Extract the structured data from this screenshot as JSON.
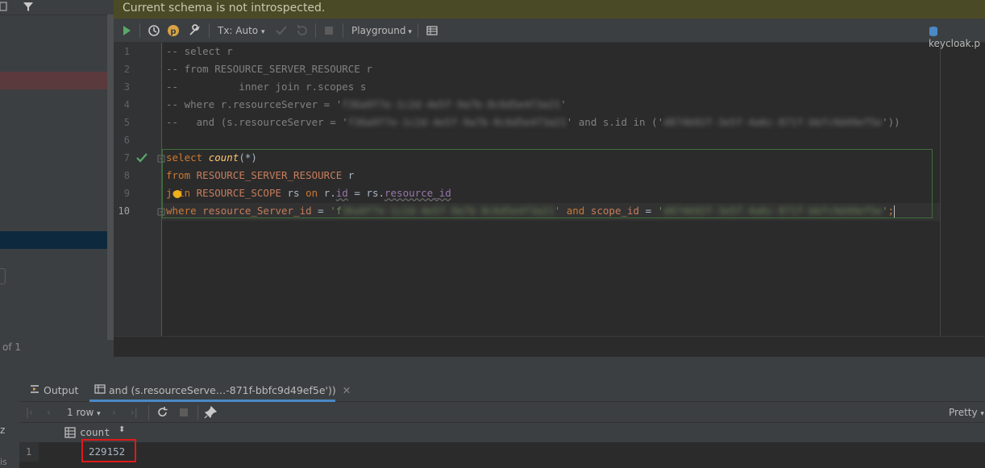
{
  "banner": {
    "message": "Current schema is not introspected."
  },
  "toolbar": {
    "tx_mode": "Tx: Auto",
    "playground": "Playground",
    "connection": "keycloak.p"
  },
  "left_panel": {
    "footer": "of 1",
    "cut_z": "z",
    "cut_s": "is"
  },
  "editor": {
    "lines": [
      "1",
      "2",
      "3",
      "4",
      "5",
      "6",
      "7",
      "8",
      "9",
      "10"
    ],
    "l1": "-- select r",
    "l2": "-- from RESOURCE_SERVER_RESOURCE r",
    "l3": "--          inner join r.scopes s",
    "l4a": "-- where r.resourceServer = '",
    "l4b": "f36a9f7e-1c2d-4e5f-9a7b-8c6d5e4f3a21",
    "l4c": "'",
    "l5a": "--   and (s.resourceServer = '",
    "l5b": "f36a9f7e-1c2d-4e5f-9a7b-8c6d5e4f3a21",
    "l5c": "' and s.id in ('",
    "l5d": "d874b92f-3e5f-4a6c-871f-bbfc9d49ef5e",
    "l5e": "'))",
    "l7_kw": "select",
    "l7_fn": "count",
    "l7_rest": "(*)",
    "l8_kw": "from",
    "l8_tbl": "RESOURCE_SERVER_RESOURCE",
    "l8_alias": "r",
    "l9_kw": "join",
    "l9_tbl": "RESOURCE_SCOPE",
    "l9_alias": "rs",
    "l9_on": "on",
    "l9_a": "r.",
    "l9_col1": "id",
    "l9_eq": " = rs.",
    "l9_col2": "resource_id",
    "l10_kw": "where",
    "l10_col1": "resource_Server_id",
    "l10_eq": " = ",
    "l10_s1a": "'f",
    "l10_s1b": "36a9f7e-1c2d-4e5f-9a7b-8c6d5e4f3a21",
    "l10_s1c": "'",
    "l10_and": "and",
    "l10_col2": "scope_id",
    "l10_s2a": "'",
    "l10_s2b": "d874b92f-3e5f-4a6c-871f-bbfc9d49ef5e",
    "l10_s2c": "'",
    "l10_end": ";"
  },
  "results": {
    "tab_output": "Output",
    "tab_query": "and (s.resourceServe…-871f-bbfc9d49ef5e'))",
    "rows_label": "1 row",
    "view_mode": "Pretty",
    "column": "count",
    "row_number": "1",
    "value": "229152"
  },
  "colors": {
    "accent": "#4a88c7",
    "highlight": "#e0191a",
    "banner_bg": "#4b4a26"
  }
}
